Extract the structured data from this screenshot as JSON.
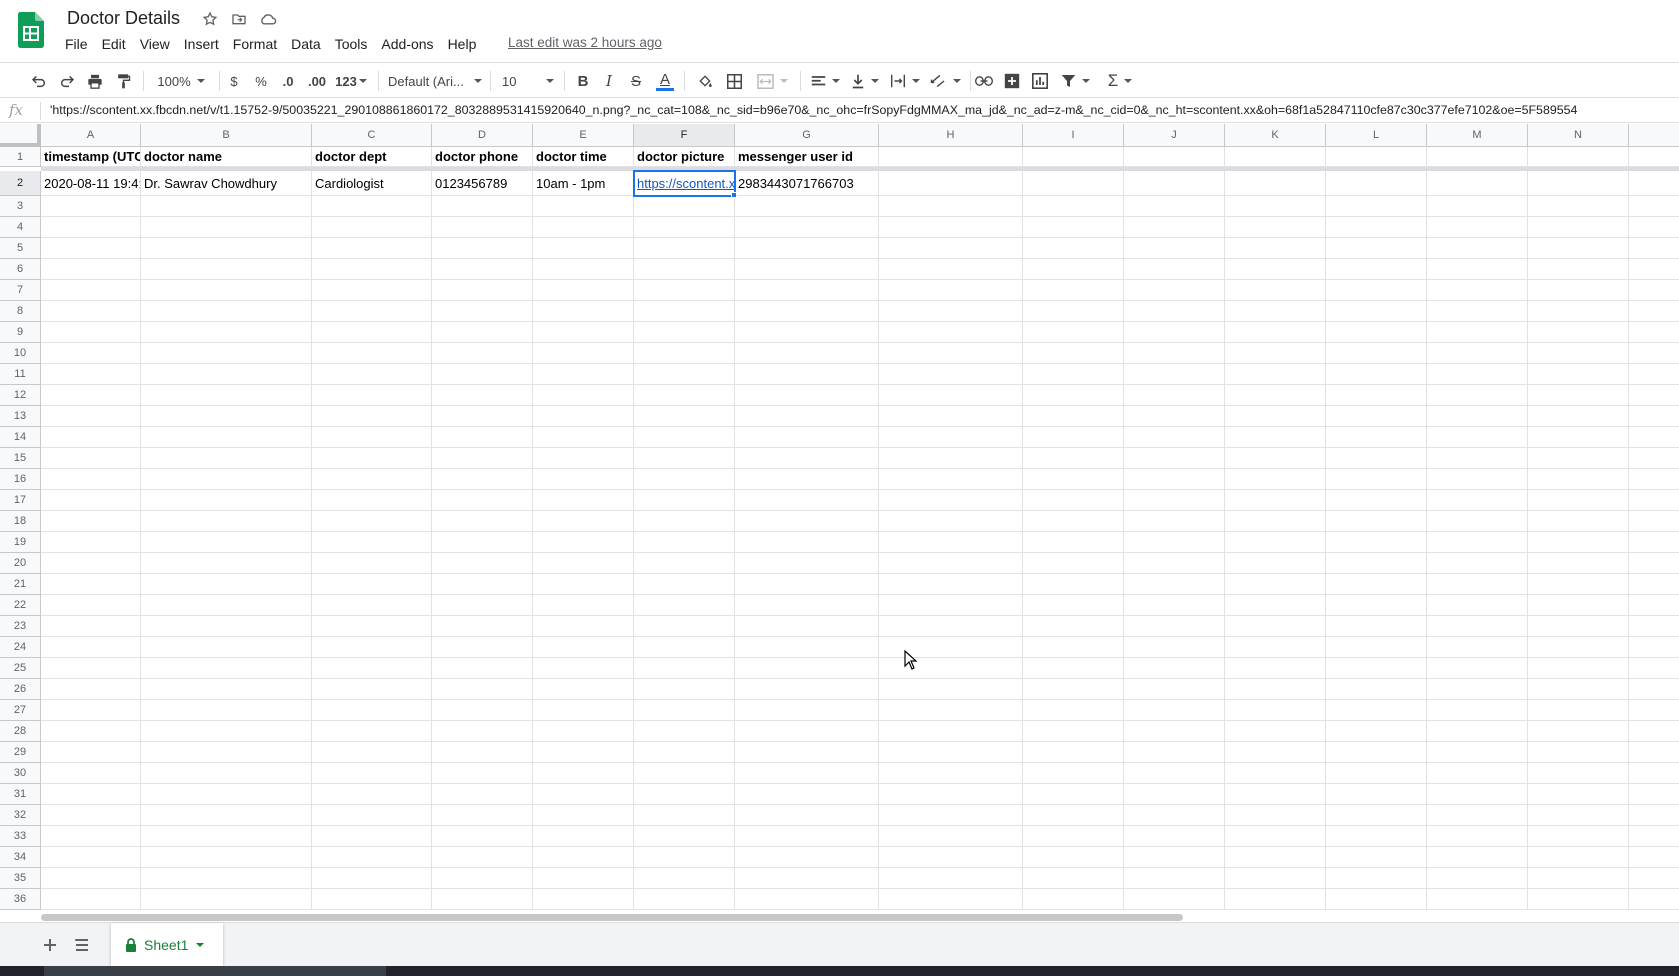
{
  "doc": {
    "title": "Doctor Details",
    "last_edit": "Last edit was 2 hours ago"
  },
  "menu": [
    "File",
    "Edit",
    "View",
    "Insert",
    "Format",
    "Data",
    "Tools",
    "Add-ons",
    "Help"
  ],
  "toolbar": {
    "zoom": "100%",
    "currency": "$",
    "percent": "%",
    "decrease_decimal": ".0",
    "increase_decimal": ".00",
    "more_formats": "123",
    "font_family": "Default (Ari...",
    "font_size": "10",
    "text_color": "#1a73e8"
  },
  "formula_bar": {
    "fx": "fx",
    "content": "'https://scontent.xx.fbcdn.net/v/t1.15752-9/50035221_290108861860172_8032889531415920640_n.png?_nc_cat=108&_nc_sid=b96e70&_nc_ohc=frSopyFdgMMAX_ma_jd&_nc_ad=z-m&_nc_cid=0&_nc_ht=scontent.xx&oh=68f1a52847110cfe87c30c377efe7102&oe=5F589554"
  },
  "grid": {
    "columns": [
      "A",
      "B",
      "C",
      "D",
      "E",
      "F",
      "G",
      "H",
      "I",
      "J",
      "K",
      "L",
      "M",
      "N"
    ],
    "selected_column": "F",
    "selected_row": "2",
    "rows": [
      [
        "timestamp (UTC",
        "doctor name",
        "doctor dept",
        "doctor phone",
        "doctor time",
        "doctor picture",
        "messenger user id"
      ],
      [
        "2020-08-11 19:4:",
        "Dr. Sawrav Chowdhury",
        "Cardiologist",
        "0123456789",
        "10am - 1pm",
        "https://scontent.x",
        "2983443071766703"
      ]
    ],
    "row_numbers": [
      "1",
      "2",
      "3",
      "4",
      "5",
      "6",
      "7",
      "8",
      "9",
      "10",
      "11",
      "12",
      "13",
      "14",
      "15",
      "16",
      "17",
      "18",
      "19",
      "20",
      "21",
      "22",
      "23",
      "24",
      "25",
      "26",
      "27",
      "28",
      "29",
      "30",
      "31",
      "32",
      "33",
      "34",
      "35",
      "36"
    ]
  },
  "sheets": [
    {
      "name": "Sheet1",
      "protected": true
    }
  ],
  "colors": {
    "accent": "#1a73e8",
    "sheets_green": "#188038",
    "link": "#1155cc"
  }
}
